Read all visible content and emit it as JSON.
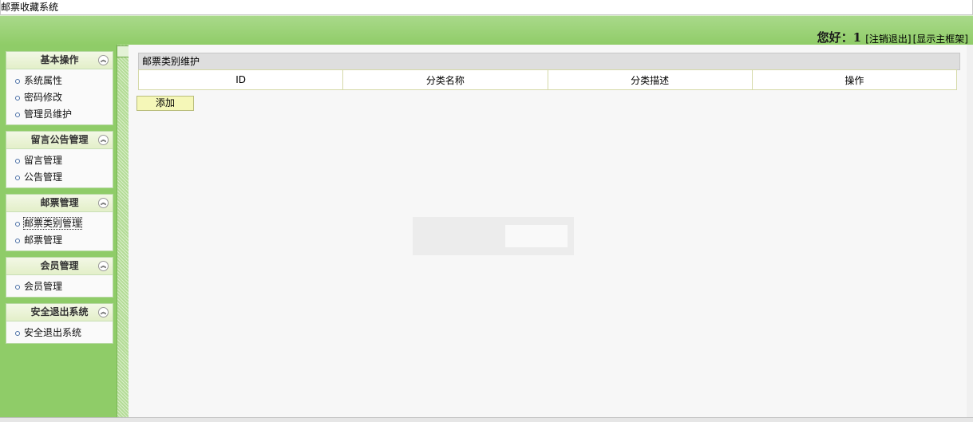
{
  "window": {
    "title": "邮票收藏系统"
  },
  "header": {
    "greeting": "您好：1",
    "logout": "[注销退出]",
    "show_frame": "[显示主框架]"
  },
  "sidebar": {
    "groups": [
      {
        "title": "基本操作",
        "items": [
          "系统属性",
          "密码修改",
          "管理员维护"
        ]
      },
      {
        "title": "留言公告管理",
        "items": [
          "留言管理",
          "公告管理"
        ]
      },
      {
        "title": "邮票管理",
        "items": [
          "邮票类别管理",
          "邮票管理"
        ]
      },
      {
        "title": "会员管理",
        "items": [
          "会员管理"
        ]
      },
      {
        "title": "安全退出系统",
        "items": [
          "安全退出系统"
        ]
      }
    ]
  },
  "main": {
    "panel_title": "邮票类别维护",
    "columns": [
      "ID",
      "分类名称",
      "分类描述",
      "操作"
    ],
    "add_button": "添加"
  },
  "colors": {
    "topbar": "#8fcc67",
    "sidebar": "#8fcc68",
    "add_button": "#f5f7b8"
  },
  "icons": {
    "collapse": "double-chevron-up-icon",
    "bullet": "circle-bullet-icon"
  }
}
